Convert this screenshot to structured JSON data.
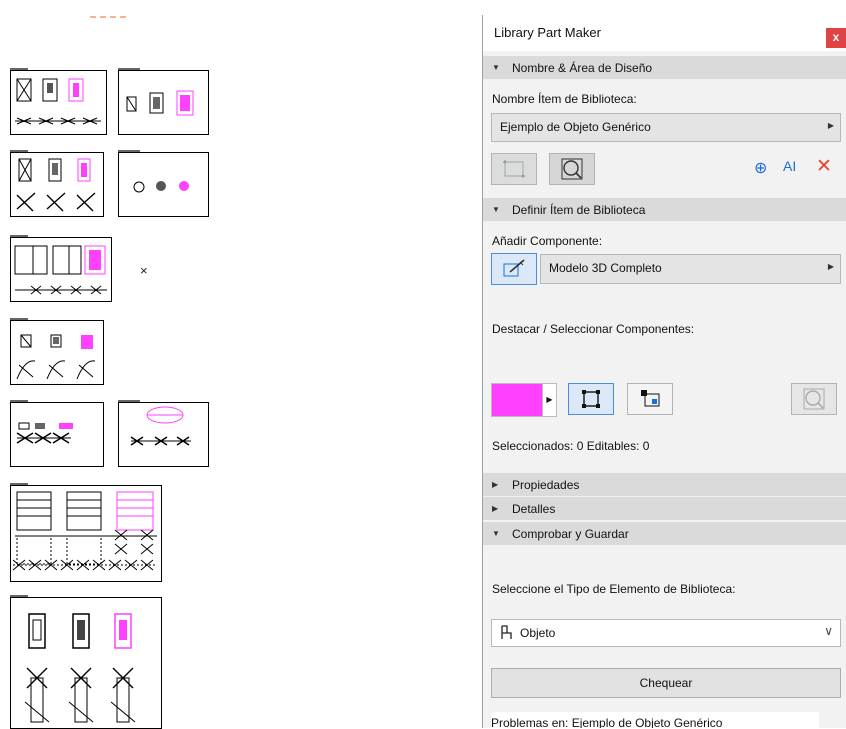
{
  "canvas": {
    "close_mark": "×"
  },
  "panel": {
    "title": "Library Part Maker",
    "close_label": "x",
    "section_name": {
      "label": "Nombre & Área de Diseño",
      "item_name_label": "Nombre Ítem de Biblioteca:",
      "item_name_value": "Ejemplo de Objeto Genérico"
    },
    "section_define": {
      "label": "Definir Ítem de Biblioteca",
      "add_component_label": "Añadir Componente:",
      "component_value": "Modelo 3D Completo",
      "highlight_label": "Destacar / Seleccionar Componentes:",
      "highlight_color": "#ff40ff",
      "selected_text": "Seleccionados: 0 Editables: 0"
    },
    "section_properties": {
      "label": "Propiedades"
    },
    "section_details": {
      "label": "Detalles"
    },
    "section_check": {
      "label": "Comprobar y Guardar",
      "type_label": "Seleccione el Tipo de Elemento de Biblioteca:",
      "type_value": "Objeto",
      "check_button": "Chequear",
      "problems_text": "Problemas en: Ejemplo de Objeto Genérico"
    },
    "icons": {
      "expanded": "▼",
      "collapsed": "▶",
      "submenu": "▶",
      "dropdown": "∨",
      "add": "⊕",
      "text_style": "AI",
      "delete": "✕",
      "scroll_up": "︿"
    },
    "colors": {
      "accent_blue": "#1a6fd6",
      "delete_red": "#e8452c",
      "close_red": "#e04343"
    }
  }
}
